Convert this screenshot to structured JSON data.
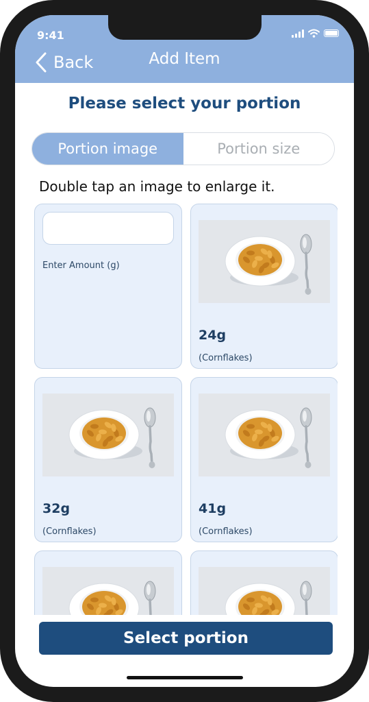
{
  "status_bar": {
    "time": "9:41",
    "icons": [
      "signal-icon",
      "wifi-icon",
      "battery-icon"
    ]
  },
  "header": {
    "back_label": "Back",
    "title": "Add Item",
    "back_icon": "chevron-left-icon"
  },
  "heading": "Please select your portion",
  "tabs": [
    {
      "label": "Portion image",
      "active": true
    },
    {
      "label": "Portion size",
      "active": false
    }
  ],
  "hint": "Double tap an image to enlarge it.",
  "custom_amount": {
    "value": "",
    "placeholder": "",
    "label": "Enter Amount (g)"
  },
  "portions": [
    {
      "weight": "24g",
      "food": "(Cornflakes)"
    },
    {
      "weight": "32g",
      "food": "(Cornflakes)"
    },
    {
      "weight": "41g",
      "food": "(Cornflakes)"
    },
    {
      "weight": "",
      "food": ""
    },
    {
      "weight": "",
      "food": ""
    }
  ],
  "select_button": "Select portion",
  "colors": {
    "header_bg": "#8eb0de",
    "primary": "#1e4d7e",
    "card_bg": "#e8f0fb",
    "card_border": "#c4d4e8"
  }
}
